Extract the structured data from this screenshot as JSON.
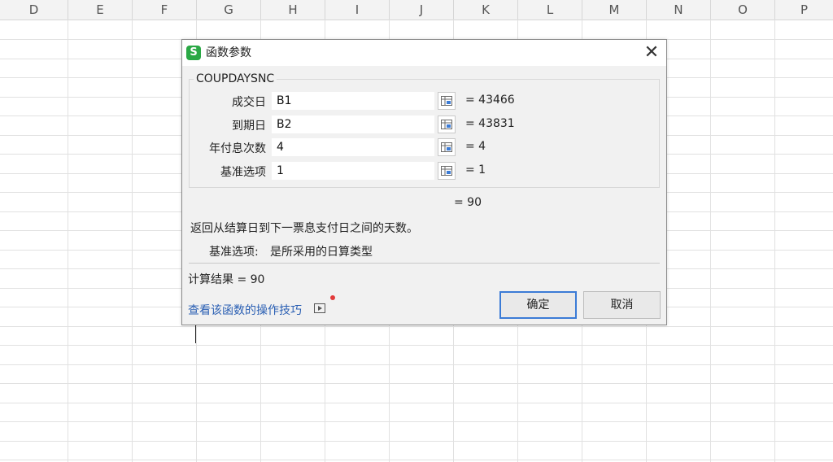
{
  "sheet": {
    "columns": [
      "D",
      "E",
      "F",
      "G",
      "H",
      "I",
      "J",
      "K",
      "L",
      "M",
      "N",
      "O",
      "P"
    ]
  },
  "dialog": {
    "title": "函数参数",
    "app_icon": "S",
    "close_glyph": "✕",
    "function_name": "COUPDAYSNC",
    "params": [
      {
        "label": "成交日",
        "value": "B1",
        "result": "= 43466"
      },
      {
        "label": "到期日",
        "value": "B2",
        "result": "= 43831"
      },
      {
        "label": "年付息次数",
        "value": "4",
        "result": "= 4"
      },
      {
        "label": "基准选项",
        "value": "1",
        "result": "= 1"
      }
    ],
    "overall_value": "= 90",
    "description": "返回从结算日到下一票息支付日之间的天数。",
    "arg_help_label": "基准选项:",
    "arg_help_text": "是所采用的日算类型",
    "result_text": "计算结果 = 90",
    "help_link": "查看该函数的操作技巧",
    "ok_label": "确定",
    "cancel_label": "取消",
    "accent_color": "#3b7bd6",
    "icon_color": "#2aa845"
  }
}
